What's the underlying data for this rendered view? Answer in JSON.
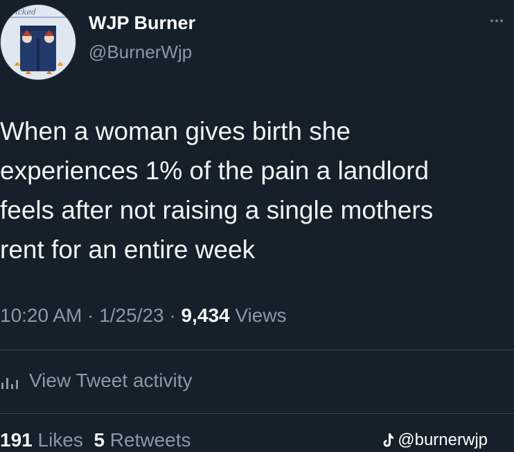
{
  "author": {
    "display_name": "WJP Burner",
    "handle": "@BurnerWjp"
  },
  "tweet": {
    "text_lines": [
      "When a woman gives birth she",
      "experiences 1% of the pain a landlord",
      "feels after not raising a single mothers",
      "rent for an entire week"
    ],
    "time": "10:20 AM",
    "date": "1/25/23",
    "separator": "·",
    "views_count": "9,434",
    "views_label": "Views"
  },
  "activity": {
    "label": "View Tweet activity",
    "icon": "bar-chart-icon"
  },
  "stats": {
    "likes_count": "191",
    "likes_label": "Likes",
    "retweets_count": "5",
    "retweets_label": "Retweets"
  },
  "watermark": {
    "icon": "tiktok-icon",
    "text": "@burnerwjp"
  },
  "colors": {
    "background": "#15202b",
    "text_primary": "#e7e9ea",
    "text_secondary": "#8b98a5",
    "divider": "#38444d"
  }
}
